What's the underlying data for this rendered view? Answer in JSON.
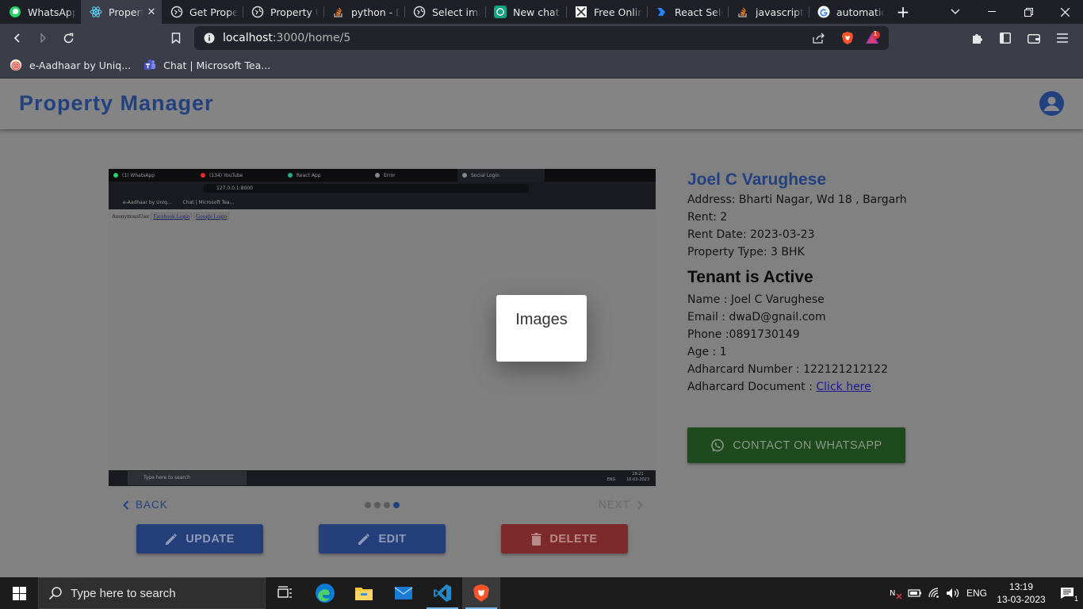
{
  "browser": {
    "tabs": [
      {
        "label": "WhatsApp",
        "icon": "whatsapp-icon",
        "active": false
      },
      {
        "label": "Property Manager",
        "icon": "react-icon",
        "active": true
      },
      {
        "label": "Get Property",
        "icon": "globe-icon",
        "active": false
      },
      {
        "label": "Property Update",
        "icon": "globe-icon",
        "active": false
      },
      {
        "label": "python - Django",
        "icon": "stackoverflow-icon",
        "active": false
      },
      {
        "label": "Select image",
        "icon": "globe-icon",
        "active": false
      },
      {
        "label": "New chat",
        "icon": "chatgpt-icon",
        "active": false
      },
      {
        "label": "Free Online",
        "icon": "site-icon",
        "active": false
      },
      {
        "label": "React Select",
        "icon": "react-select-icon",
        "active": false
      },
      {
        "label": "javascript -",
        "icon": "stackoverflow-icon",
        "active": false
      },
      {
        "label": "automatically",
        "icon": "google-icon",
        "active": false
      }
    ],
    "url_host": "localhost",
    "url_path": ":3000/home/5",
    "brave_badge": "1",
    "bookmarks": [
      {
        "label": "e-Aadhaar by Uniq...",
        "icon": "aadhaar-icon"
      },
      {
        "label": "Chat | Microsoft Tea...",
        "icon": "teams-icon"
      }
    ]
  },
  "app": {
    "title": "Property Manager",
    "accent": "#23417f"
  },
  "carousel": {
    "popup_label": "Images",
    "back_label": "BACK",
    "next_label": "NEXT",
    "dot_count": 4,
    "active_dot": 4,
    "inner_screenshot": {
      "tabs": [
        "(1) WhatsApp",
        "(134) YouTube",
        "React App",
        "Error",
        "Social Login"
      ],
      "url": "127.0.0.1:8000",
      "bookmarks": [
        "e-Aadhaar by Uniq...",
        "Chat | Microsoft Tea..."
      ],
      "user_text": "AnonymousUser",
      "facebook_link": "Facebook Login",
      "google_link": "Google Login",
      "search_placeholder": "Type here to search",
      "tray_lang": "ENG",
      "tray_time": "23:21",
      "tray_date": "10-03-2023"
    }
  },
  "actions": {
    "update": "UPDATE",
    "edit": "EDIT",
    "delete": "DELETE"
  },
  "property": {
    "owner": "Joel C Varughese",
    "address": "Address: Bharti Nagar, Wd 18 , Bargarh",
    "rent": "Rent: 2",
    "rent_date": "Rent Date: 2023-03-23",
    "type": "Property Type: 3 BHK"
  },
  "tenant": {
    "status": "Tenant is Active",
    "name": "Name : Joel C Varughese",
    "email": "Email : dwaD@gnail.com",
    "phone": "Phone :0891730149",
    "age": "Age : 1",
    "aadhar_number": "Adharcard Number : 122121212122",
    "aadhar_doc_label": "Adharcard Document : ",
    "aadhar_doc_link": "Click here"
  },
  "contact_button": "CONTACT ON WHATSAPP",
  "taskbar": {
    "search_placeholder": "Type here to search",
    "lang": "ENG",
    "time": "13:19",
    "date": "13-03-2023",
    "notification_count": "1"
  }
}
